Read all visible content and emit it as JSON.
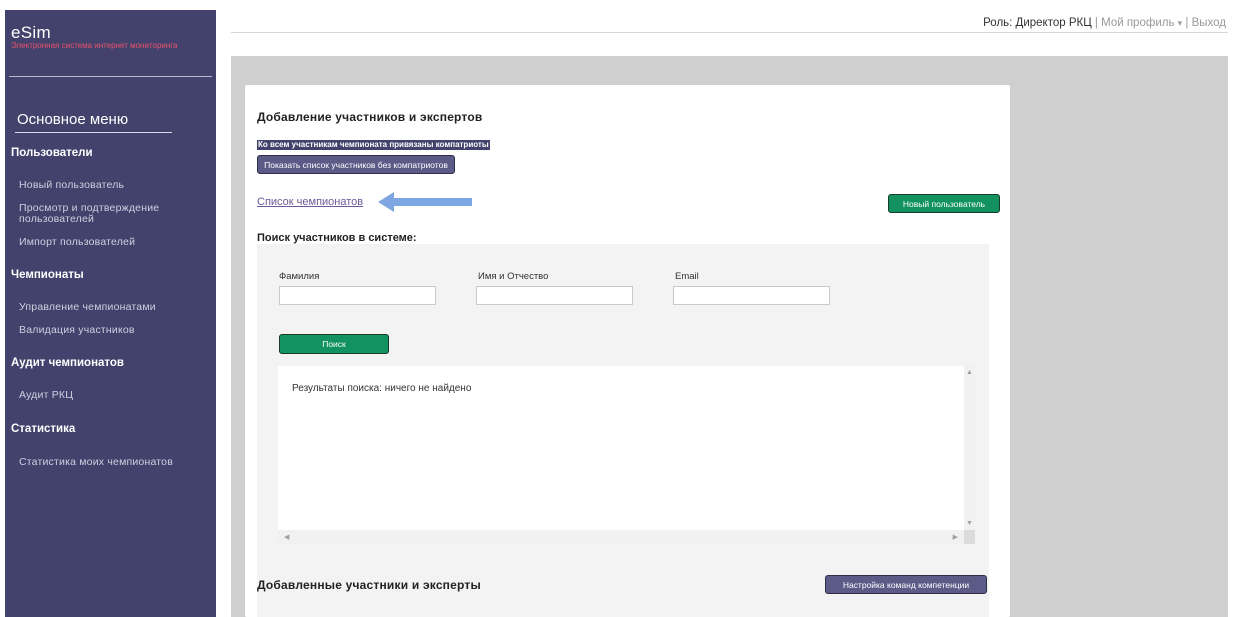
{
  "sidebar": {
    "brand": "eSim",
    "brand_sub": "Электронная система интернет мониторинга",
    "main_menu": "Основное меню",
    "sections": [
      {
        "title": "Пользователи",
        "items": [
          "Новый пользователь",
          "Просмотр и подтверждение пользователей",
          "Импорт пользователей"
        ]
      },
      {
        "title": "Чемпионаты",
        "items": [
          "Управление чемпионатами",
          "Валидация участников"
        ]
      },
      {
        "title": "Аудит чемпионатов",
        "items": [
          "Аудит РКЦ"
        ]
      },
      {
        "title": "Статистика",
        "items": [
          "Статистика моих чемпионатов"
        ]
      }
    ]
  },
  "header": {
    "role": "Роль: Директор РКЦ",
    "profile": "Мой профиль",
    "dropdown_glyph": "▾",
    "logout": "Выход"
  },
  "card": {
    "title": "Добавление участников и экспертов",
    "notice": "Ко всем участникам чемпионата привязаны компатриоты",
    "show_without_button": "Показать список участников без компатриотов",
    "championships_link": "Список чемпионатов",
    "new_user_button": "Новый пользователь",
    "search_title": "Поиск участников в системе:",
    "fields": {
      "lastname_label": "Фамилия",
      "name_label": "Имя и Отчество",
      "email_label": "Email",
      "lastname_value": "",
      "name_value": "",
      "email_value": ""
    },
    "search_button": "Поиск",
    "results_text": "Результаты поиска: ничего не найдено",
    "added_title": "Добавленные участники и эксперты",
    "team_settings_button": "Настройка команд компетенции"
  },
  "colors": {
    "sidebar_bg": "#43426c",
    "accent_green": "#12925e",
    "accent_purple": "#5c5a87",
    "brand_sub": "#e8526b",
    "arrow": "#7ea6e0"
  },
  "icons": {
    "arrow": "left-arrow-icon",
    "dropdown": "chevron-down-icon"
  }
}
